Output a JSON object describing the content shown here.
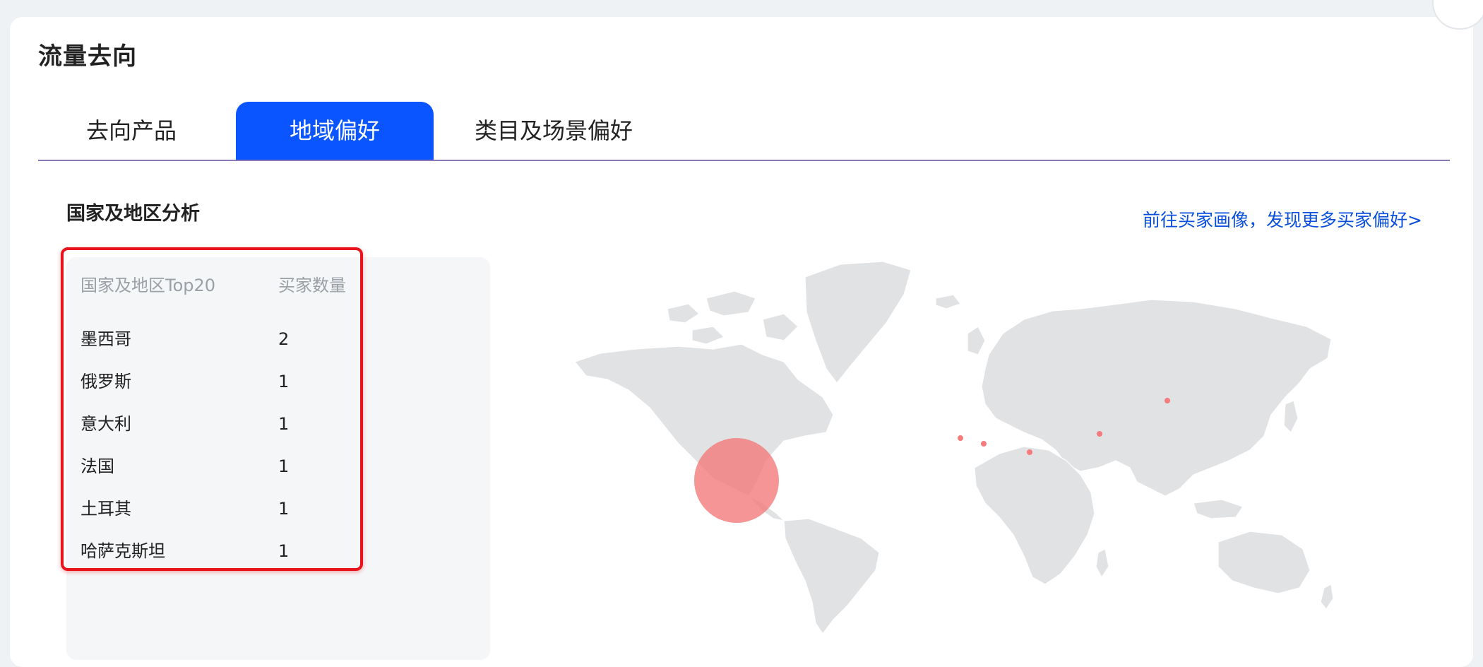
{
  "section_title": "流量去向",
  "tabs": [
    {
      "label": "去向产品",
      "active": false
    },
    {
      "label": "地域偏好",
      "active": true
    },
    {
      "label": "类目及场景偏好",
      "active": false
    }
  ],
  "region": {
    "title": "国家及地区分析",
    "link_label": "前往买家画像，发现更多买家偏好>",
    "table": {
      "headers": [
        "国家及地区Top20",
        "买家数量"
      ],
      "rows": [
        {
          "country": "墨西哥",
          "count": "2"
        },
        {
          "country": "俄罗斯",
          "count": "1"
        },
        {
          "country": "意大利",
          "count": "1"
        },
        {
          "country": "法国",
          "count": "1"
        },
        {
          "country": "土耳其",
          "count": "1"
        },
        {
          "country": "哈萨克斯坦",
          "count": "1"
        }
      ]
    }
  },
  "colors": {
    "active_tab": "#0a55ff",
    "link": "#0a4fdc",
    "highlight_border": "#e8131b",
    "map_land": "#e1e2e4",
    "marker": "#f37b7b"
  }
}
